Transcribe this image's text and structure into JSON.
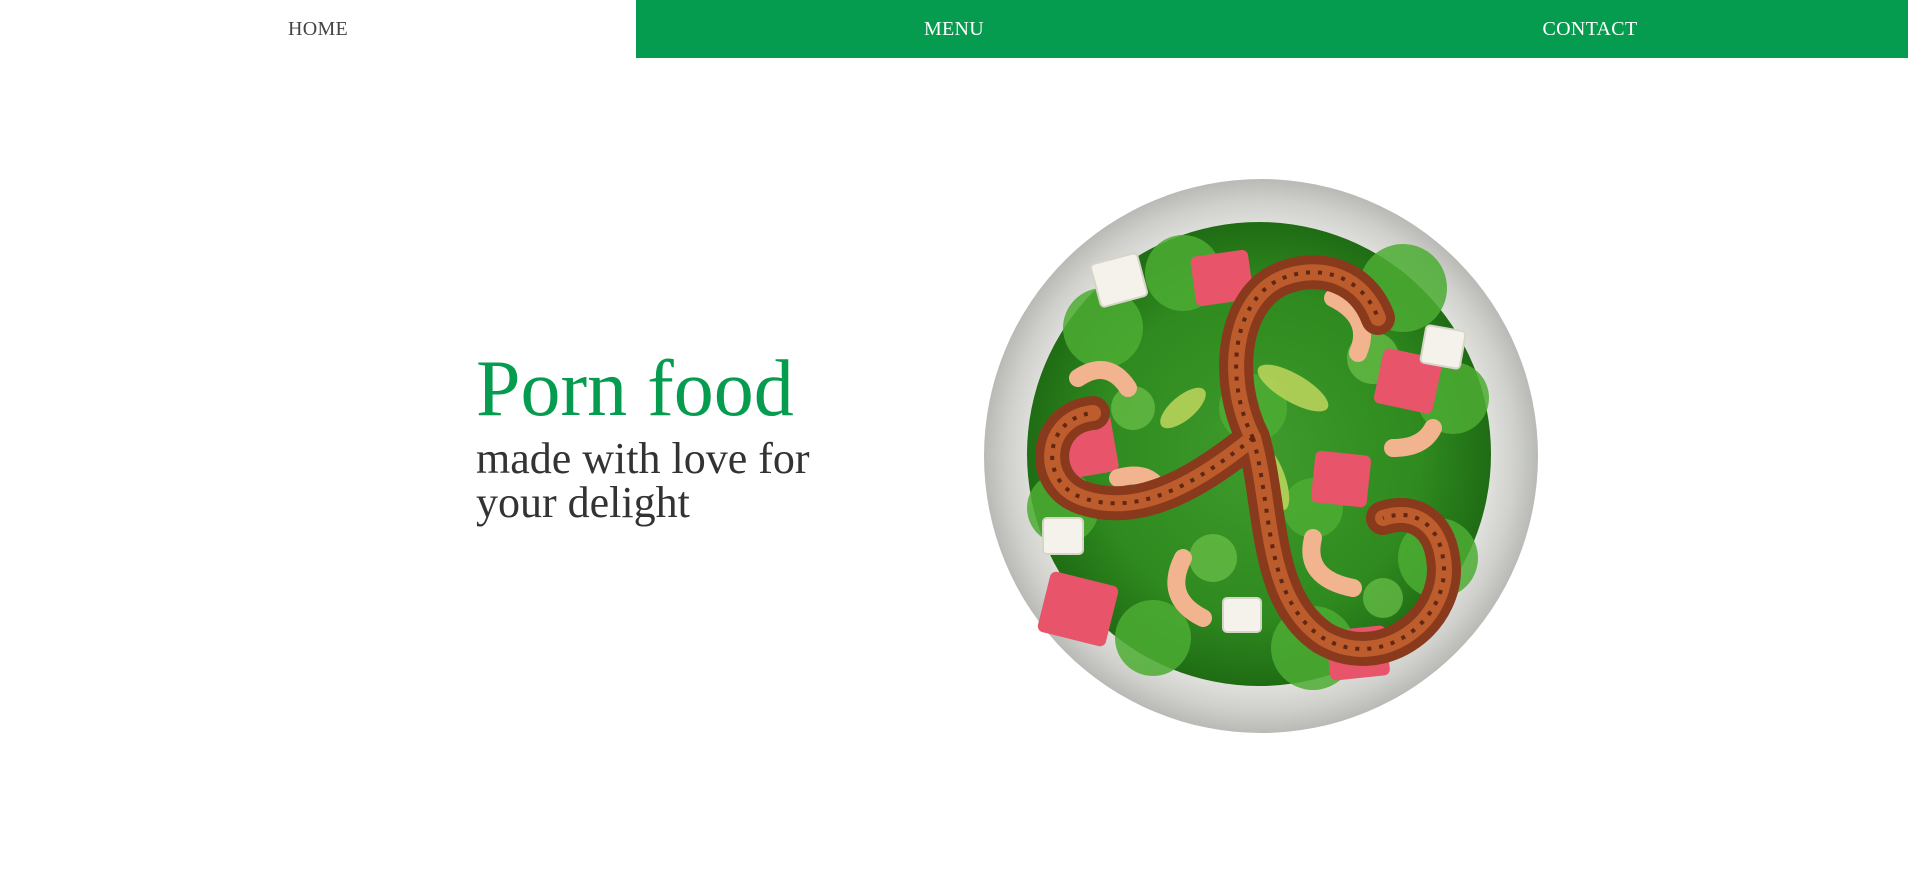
{
  "nav": {
    "items": [
      {
        "label": "HOME",
        "active": true
      },
      {
        "label": "MENU",
        "active": false
      },
      {
        "label": "CONTACT",
        "active": false
      }
    ],
    "colors": {
      "accent": "#069c4f",
      "active_text": "#444444",
      "text": "#ffffff"
    }
  },
  "hero": {
    "title": "Porn food",
    "subtitle": "made with love for your delight",
    "title_color": "#069c4f",
    "subtitle_color": "#333333"
  },
  "image": {
    "icon": "salad-plate-image"
  }
}
